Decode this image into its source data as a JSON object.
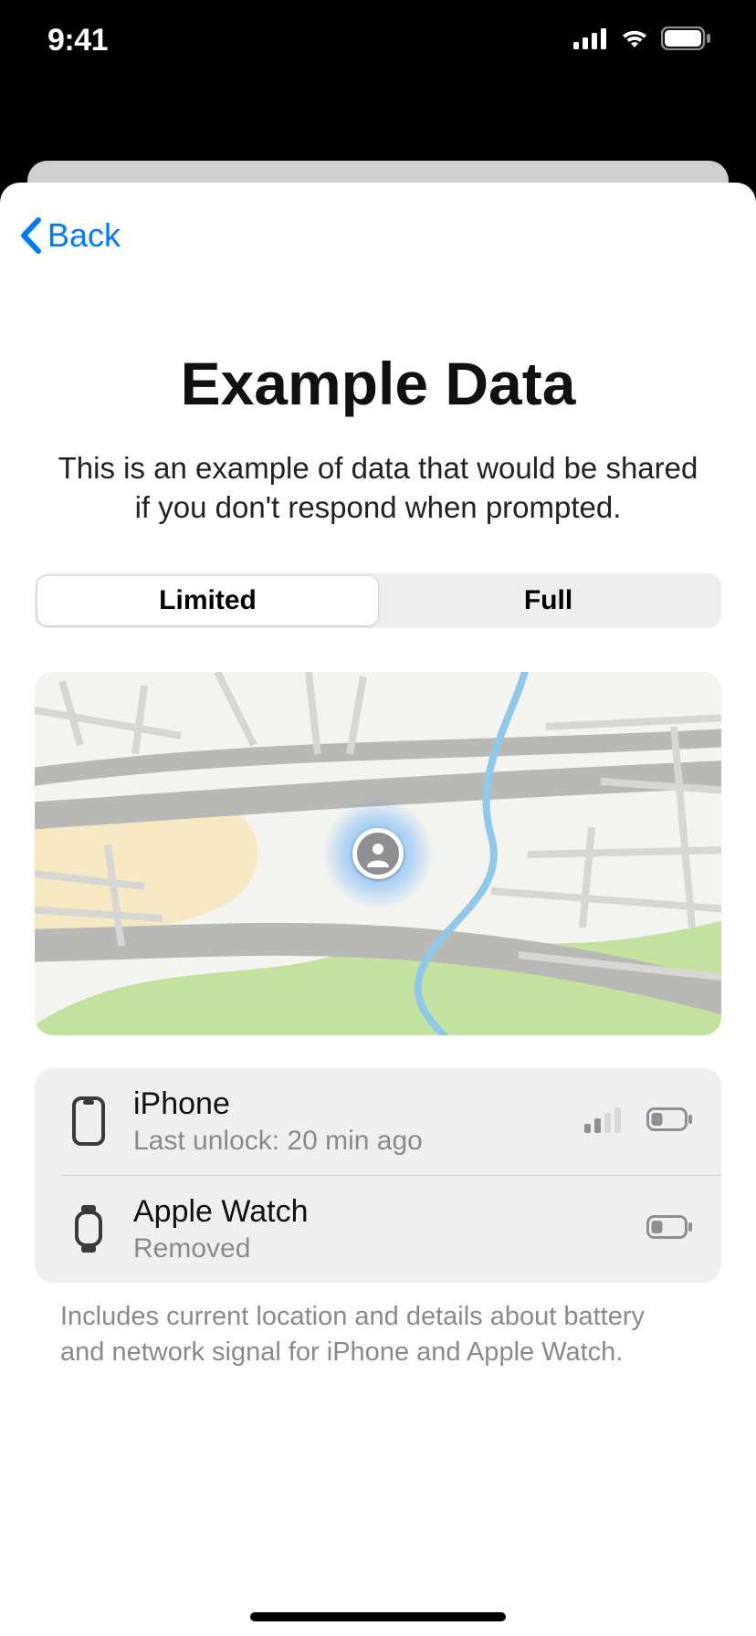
{
  "status": {
    "time": "9:41"
  },
  "nav": {
    "back_label": "Back"
  },
  "title": "Example Data",
  "subtitle": "This is an example of data that would be shared if you don't respond when prompted.",
  "segments": {
    "limited": "Limited",
    "full": "Full",
    "selected": "limited"
  },
  "devices": [
    {
      "name": "iPhone",
      "sub": "Last unlock: 20 min ago",
      "signal": 2,
      "battery": "low",
      "show_signal": true
    },
    {
      "name": "Apple Watch",
      "sub": "Removed",
      "battery": "low",
      "show_signal": false
    }
  ],
  "footnote": "Includes current location and details about battery and network signal for iPhone and Apple Watch."
}
